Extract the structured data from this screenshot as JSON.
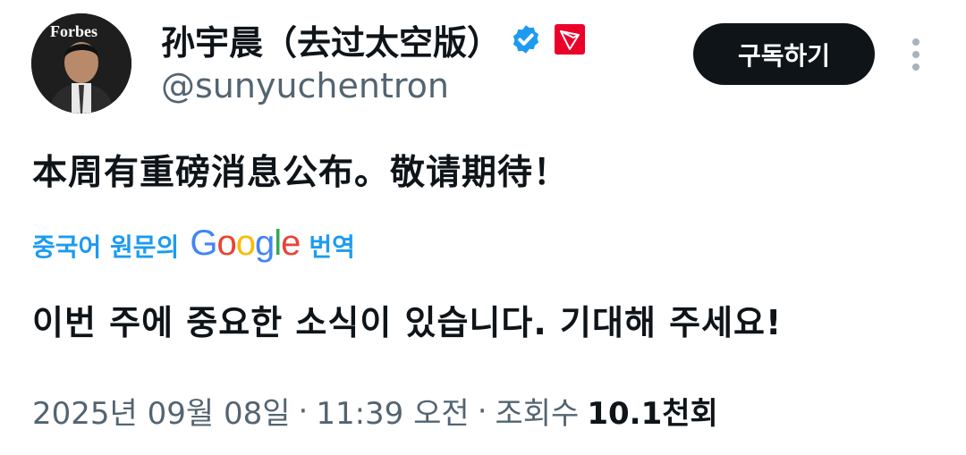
{
  "author": {
    "avatar_text": "Forbes",
    "display_name": "孙宇晨（去过太空版）",
    "handle": "@sunyuchentron",
    "verified_color": "#1d9bf0",
    "tron_color": "#eb0029"
  },
  "actions": {
    "subscribe_label": "구독하기"
  },
  "post": {
    "text": "本周有重磅消息公布。敬请期待！",
    "translate_prefix": "중국어 원문의",
    "translate_brand": "Google",
    "translate_suffix": "번역",
    "translated_text": "이번 주에 중요한 소식이 있습니다. 기대해 주세요!"
  },
  "meta": {
    "date": "2025년 09월 08일",
    "separator": "·",
    "time": "11:39 오전",
    "views_label": "조회수",
    "views_count": "10.1천회"
  }
}
